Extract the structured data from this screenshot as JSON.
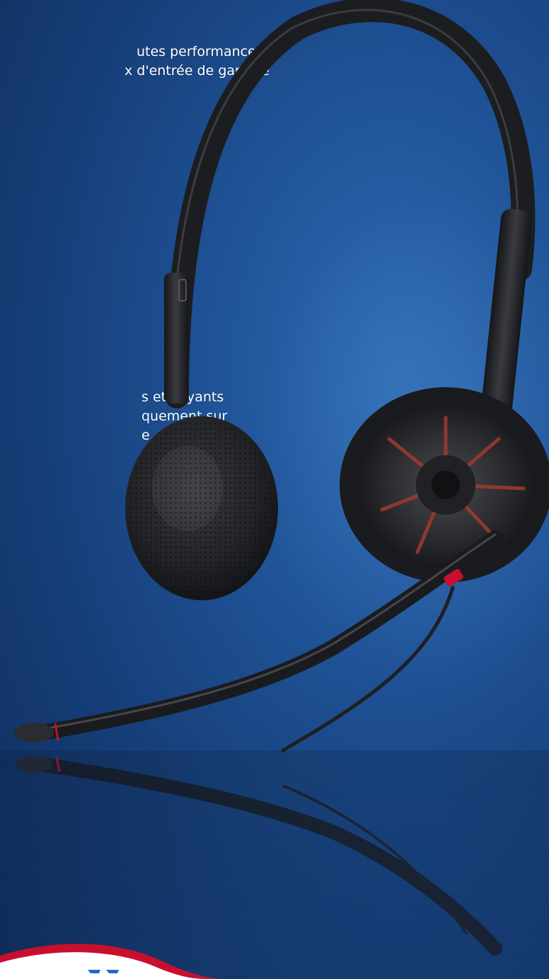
{
  "copy_top": {
    "line1": "utes performances,",
    "line2": "x d'entrée de gamme"
  },
  "copy_mid": {
    "line1": "s et voyants",
    "line2": "quement sur",
    "line3": "e"
  },
  "colors": {
    "background": "#1a4a8a",
    "accent_red": "#c8102e",
    "headset_black": "#1c1d20",
    "logo_blue": "#1f6ad0"
  },
  "icons": {
    "product": "stereo-headset-image",
    "footer_swoosh": "red-wave-shape"
  }
}
